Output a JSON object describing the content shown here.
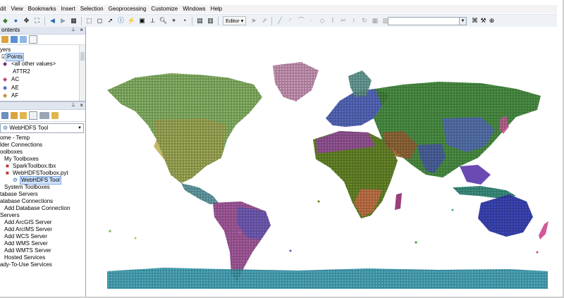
{
  "menu": [
    "dit",
    "View",
    "Bookmarks",
    "Insert",
    "Selection",
    "Geoprocessing",
    "Customize",
    "Windows",
    "Help"
  ],
  "toolbar": {
    "editor_label": "Editor"
  },
  "toc": {
    "title": "ontents",
    "layers_label": "yers",
    "layer_name": "Points",
    "all_other_values": "<all other values>",
    "field_name": "ATTR2",
    "values": [
      "AC",
      "AE",
      "AF"
    ]
  },
  "catalog": {
    "location": "WebHDFS Tool",
    "tree": [
      "ome - Temp",
      "lder Connections",
      "oolboxes",
      "My Toolboxes",
      "SparkToolbox.tbx",
      "WebHDFSToolbox.pyt",
      "WebHDFS Tool",
      "System Toolboxes",
      "tabase Servers",
      "atabase Connections",
      "Add Database Connection",
      "Servers",
      "Add ArcGIS Server",
      "Add ArcIMS Server",
      "Add WCS Server",
      "Add WMS Server",
      "Add WMTS Server",
      "Hosted Services",
      "ady-To-Use Services"
    ]
  },
  "colors": {
    "antarctica": "#4fb3c8",
    "north_america": "#8fbf6a",
    "south_america": "#b060a8",
    "africa": "#6c8f2a",
    "europe": "#5b6fc9",
    "asia": "#4f9a48",
    "australia": "#3f49c4",
    "outline": "#1a1a1a"
  }
}
